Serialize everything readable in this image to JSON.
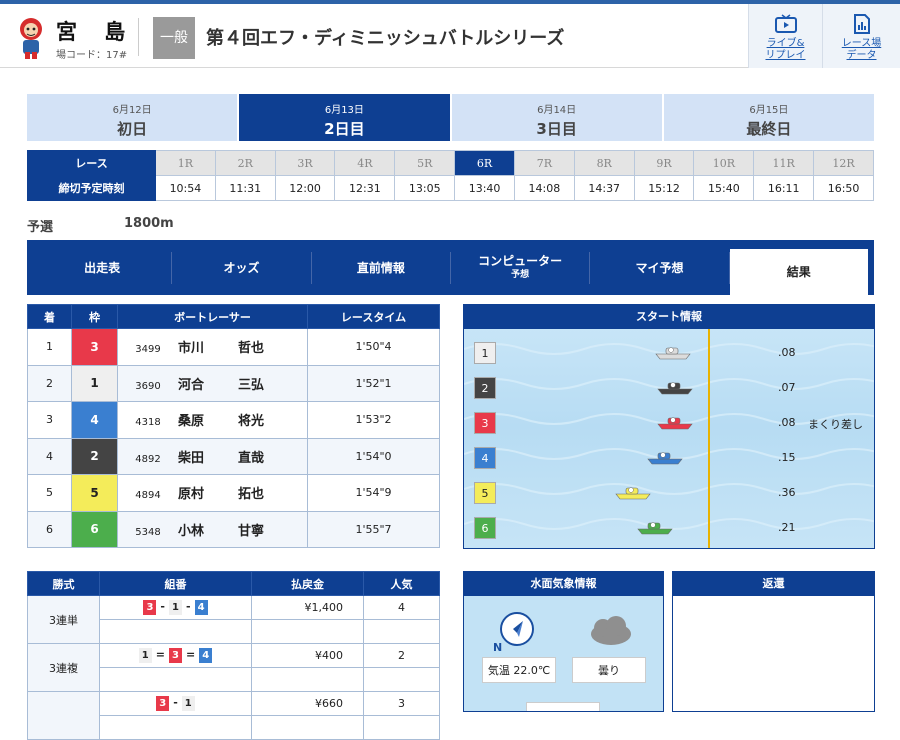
{
  "header": {
    "venue_name": "宮 島",
    "venue_code": "場コード：17#",
    "grade": "一般",
    "race_title": "第４回エフ・ディミニッシュバトルシリーズ",
    "live_label_1": "ライブ&",
    "live_label_2": "リプレイ",
    "data_label_1": "レース場",
    "data_label_2": "データ"
  },
  "days": [
    {
      "date": "6月12日",
      "name": "初日"
    },
    {
      "date": "6月13日",
      "name": "2日目"
    },
    {
      "date": "6月14日",
      "name": "3日目"
    },
    {
      "date": "6月15日",
      "name": "最終日"
    }
  ],
  "race_table": {
    "race_label": "レース",
    "deadline_label": "締切予定時刻",
    "races": [
      "1R",
      "2R",
      "3R",
      "4R",
      "5R",
      "6R",
      "7R",
      "8R",
      "9R",
      "10R",
      "11R",
      "12R"
    ],
    "times": [
      "10:54",
      "11:31",
      "12:00",
      "12:31",
      "13:05",
      "13:40",
      "14:08",
      "14:37",
      "15:12",
      "15:40",
      "16:11",
      "16:50"
    ],
    "selected": "6R"
  },
  "race_info": {
    "type": "予選",
    "distance": "1800m"
  },
  "tabs": [
    {
      "label": "出走表",
      "sub": ""
    },
    {
      "label": "オッズ",
      "sub": ""
    },
    {
      "label": "直前情報",
      "sub": ""
    },
    {
      "label": "コンピューター",
      "sub": "予想"
    },
    {
      "label": "マイ予想",
      "sub": ""
    },
    {
      "label": "結果",
      "sub": ""
    }
  ],
  "results": {
    "headers": [
      "着",
      "枠",
      "ボートレーサー",
      "レースタイム"
    ],
    "rows": [
      {
        "place": "1",
        "frame": "3",
        "id": "3499",
        "last": "市川",
        "first": "哲也",
        "time": "1'50\"4"
      },
      {
        "place": "2",
        "frame": "1",
        "id": "3690",
        "last": "河合",
        "first": "三弘",
        "time": "1'52\"1"
      },
      {
        "place": "3",
        "frame": "4",
        "id": "4318",
        "last": "桑原",
        "first": "将光",
        "time": "1'53\"2"
      },
      {
        "place": "4",
        "frame": "2",
        "id": "4892",
        "last": "柴田",
        "first": "直哉",
        "time": "1'54\"0"
      },
      {
        "place": "5",
        "frame": "5",
        "id": "4894",
        "last": "原村",
        "first": "拓也",
        "time": "1'54\"9"
      },
      {
        "place": "6",
        "frame": "6",
        "id": "5348",
        "last": "小林",
        "first": "甘寧",
        "time": "1'55\"7"
      }
    ]
  },
  "start_info": {
    "title": "スタート情報",
    "rows": [
      {
        "lane": "1",
        "st": ".08",
        "comment": ""
      },
      {
        "lane": "2",
        "st": ".07",
        "comment": ""
      },
      {
        "lane": "3",
        "st": ".08",
        "comment": "まくり差し"
      },
      {
        "lane": "4",
        "st": ".15",
        "comment": ""
      },
      {
        "lane": "5",
        "st": ".36",
        "comment": ""
      },
      {
        "lane": "6",
        "st": ".21",
        "comment": ""
      }
    ]
  },
  "payout": {
    "headers": [
      "勝式",
      "組番",
      "払戻金",
      "人気"
    ],
    "rows": [
      {
        "type": "3連単",
        "combo": [
          "3",
          "1",
          "4"
        ],
        "sep": [
          "-",
          "-"
        ],
        "amount": "¥1,400",
        "pop": "4"
      },
      {
        "type": "3連複",
        "combo": [
          "1",
          "3",
          "4"
        ],
        "sep": [
          "=",
          "="
        ],
        "amount": "¥400",
        "pop": "2"
      },
      {
        "type": "",
        "combo": [
          "3",
          "1"
        ],
        "sep": [
          "-"
        ],
        "amount": "¥660",
        "pop": "3"
      }
    ]
  },
  "weather": {
    "title": "水面気象情報",
    "wind_dir_label": "N",
    "temp": "気温 22.0℃",
    "condition": "曇り"
  },
  "refund": {
    "title": "返還"
  },
  "colors": {
    "navy": "#0e3f92",
    "frame1": "#efefef",
    "frame2": "#444444",
    "frame3": "#e8394a",
    "frame4": "#3a7fd0",
    "frame5": "#f4ec5a",
    "frame6": "#4cae4c"
  }
}
